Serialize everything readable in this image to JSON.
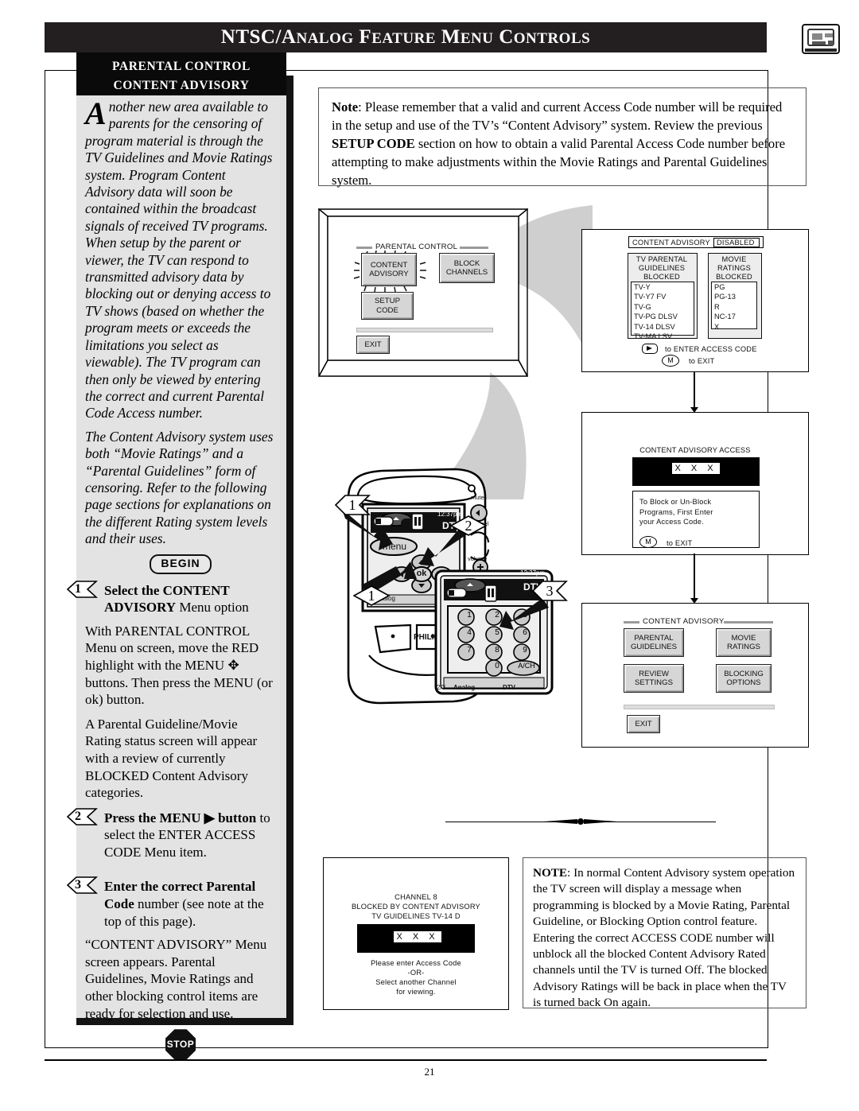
{
  "header": {
    "title_main": "NTSC/A",
    "title_full": "NTSC/ANALOG FEATURE MENU CONTROLS",
    "parts": [
      "NTSC/A",
      "NALOG",
      " F",
      "EATURE",
      " M",
      "ENU",
      " C",
      "ONTROLS"
    ],
    "corner_icon": "tv-screen-icon"
  },
  "page_number": "21",
  "sidebar": {
    "head_line1": "PARENTAL CONTROL",
    "head_line2": "CONTENT ADVISORY",
    "dropcap": "A",
    "intro_p1": "nother new area available to parents for the censoring of program material is through the TV Guidelines and Movie Ratings system. Program Content Advisory data will soon be contained within the broadcast signals of received TV programs. When setup by the parent or viewer, the TV can respond to transmitted advisory data by blocking out or denying access to TV shows (based on whether the program meets or exceeds the limitations you select as viewable). The TV program can then only be viewed by entering the correct and current Parental Code Access number.",
    "intro_p2": "The Content Advisory system uses both “Movie Ratings” and a “Parental Guidelines” form of censoring. Refer to the following page sections for explanations on the different Rating system levels and their uses.",
    "begin_label": "BEGIN",
    "stop_label": "STOP",
    "steps": [
      {
        "num": "1",
        "bold_head": "Select the CONTENT ADVISORY",
        "head_tail": " Menu option",
        "paras": [
          "With PARENTAL CONTROL Menu on screen, move the RED highlight with the MENU ✥ buttons. Then press the MENU (or ok) button.",
          "A Parental Guideline/Movie Rating status screen will appear with a review of currently BLOCKED Content Advisory categories."
        ]
      },
      {
        "num": "2",
        "bold_head": "Press the MENU ▶ button",
        "head_tail": " to select the ENTER ACCESS CODE Menu item.",
        "paras": []
      },
      {
        "num": "3",
        "bold_head": "Enter the correct Parental Code",
        "head_tail": " number (see note at the top of this page).",
        "paras": [
          "“CONTENT ADVISORY” Menu screen appears. Parental Guidelines, Movie Ratings and other blocking control items are ready for selection and use."
        ]
      }
    ]
  },
  "note_top": {
    "label": "Note",
    "text": ": Please remember that a valid and current Access Code number will be required in the setup and use of the TV’s “Content Advisory” system. Review the previous ",
    "bold_mid": "SETUP CODE",
    "text2": " section on how to obtain a valid Parental Access Code number before attempting to make adjustments within the Movie Ratings and Parental Guidelines system."
  },
  "tv_menu": {
    "title": "PARENTAL CONTROL",
    "buttons": [
      {
        "line1": "CONTENT",
        "line2": "ADVISORY"
      },
      {
        "line1": "BLOCK",
        "line2": "CHANNELS"
      },
      {
        "line1": "SETUP",
        "line2": "CODE"
      }
    ],
    "exit": "EXIT"
  },
  "status_panel": {
    "header_label": "CONTENT ADVISORY",
    "header_state": "DISABLED",
    "left_box": {
      "title_lines": [
        "TV PARENTAL",
        "GUIDELINES",
        "BLOCKED"
      ],
      "items": [
        "TV-Y",
        "TV-Y7  FV",
        "TV-G",
        "TV-PG DLSV",
        "TV-14  DLSV",
        "TV-MA LSV"
      ]
    },
    "right_box": {
      "title_lines": [
        "MOVIE",
        "RATINGS",
        "BLOCKED"
      ],
      "items": [
        "PG",
        "PG-13",
        "R",
        "NC-17",
        "X"
      ]
    },
    "hint1": "to ENTER ACCESS CODE",
    "hint2": "to EXIT",
    "m_key": "M"
  },
  "access_panel": {
    "title": "CONTENT ADVISORY ACCESS",
    "code_value": "X  X  X  X",
    "msg_lines": [
      "To Block or Un-Block",
      "Programs, First Enter",
      "your Access Code."
    ],
    "exit_hint": "to EXIT",
    "m_key": "M"
  },
  "advisory_panel": {
    "title": "CONTENT ADVISORY",
    "buttons": [
      {
        "line1": "PARENTAL",
        "line2": "GUIDELINES"
      },
      {
        "line1": "MOVIE",
        "line2": "RATINGS"
      },
      {
        "line1": "REVIEW",
        "line2": "SETTINGS"
      },
      {
        "line1": "BLOCKING",
        "line2": "OPTIONS"
      }
    ],
    "exit": "EXIT"
  },
  "blocked_screen": {
    "line1": "CHANNEL 8",
    "line2": "BLOCKED BY CONTENT ADVISORY",
    "line3": "TV GUIDELINES TV-14  D",
    "code_value": "X  X  X  X",
    "foot1": "Please enter Access Code",
    "foot2": "-OR-",
    "foot3": "Select another Channel",
    "foot4": "for viewing."
  },
  "note_bottom": {
    "label": "NOTE",
    "text": ": In normal Content Advisory system operation the TV screen will display a message when programming is blocked by a Movie Rating, Parental Guideline, or Blocking Option control feature. Entering the correct ACCESS CODE number will unblock all the blocked Content Advisory Rated channels until the TV is turned Off. The blocked Advisory Ratings will be back in place when the TV is turned back On again."
  },
  "remote": {
    "callouts": [
      "1",
      "2",
      "1",
      "3"
    ],
    "menu_label": "menu",
    "ok_label": "ok",
    "brand": "PHILIPS",
    "time": "12:37pm",
    "dtv_label": "DTV",
    "analog_label": "Analog",
    "page_indicator": "2/3",
    "mute_label": "mute",
    "channel_label": "channel",
    "volume_label": "volume",
    "keys": [
      "1",
      "2",
      "3",
      "4",
      "5",
      "6",
      "7",
      "8",
      "9",
      "0",
      "A/CH"
    ]
  }
}
